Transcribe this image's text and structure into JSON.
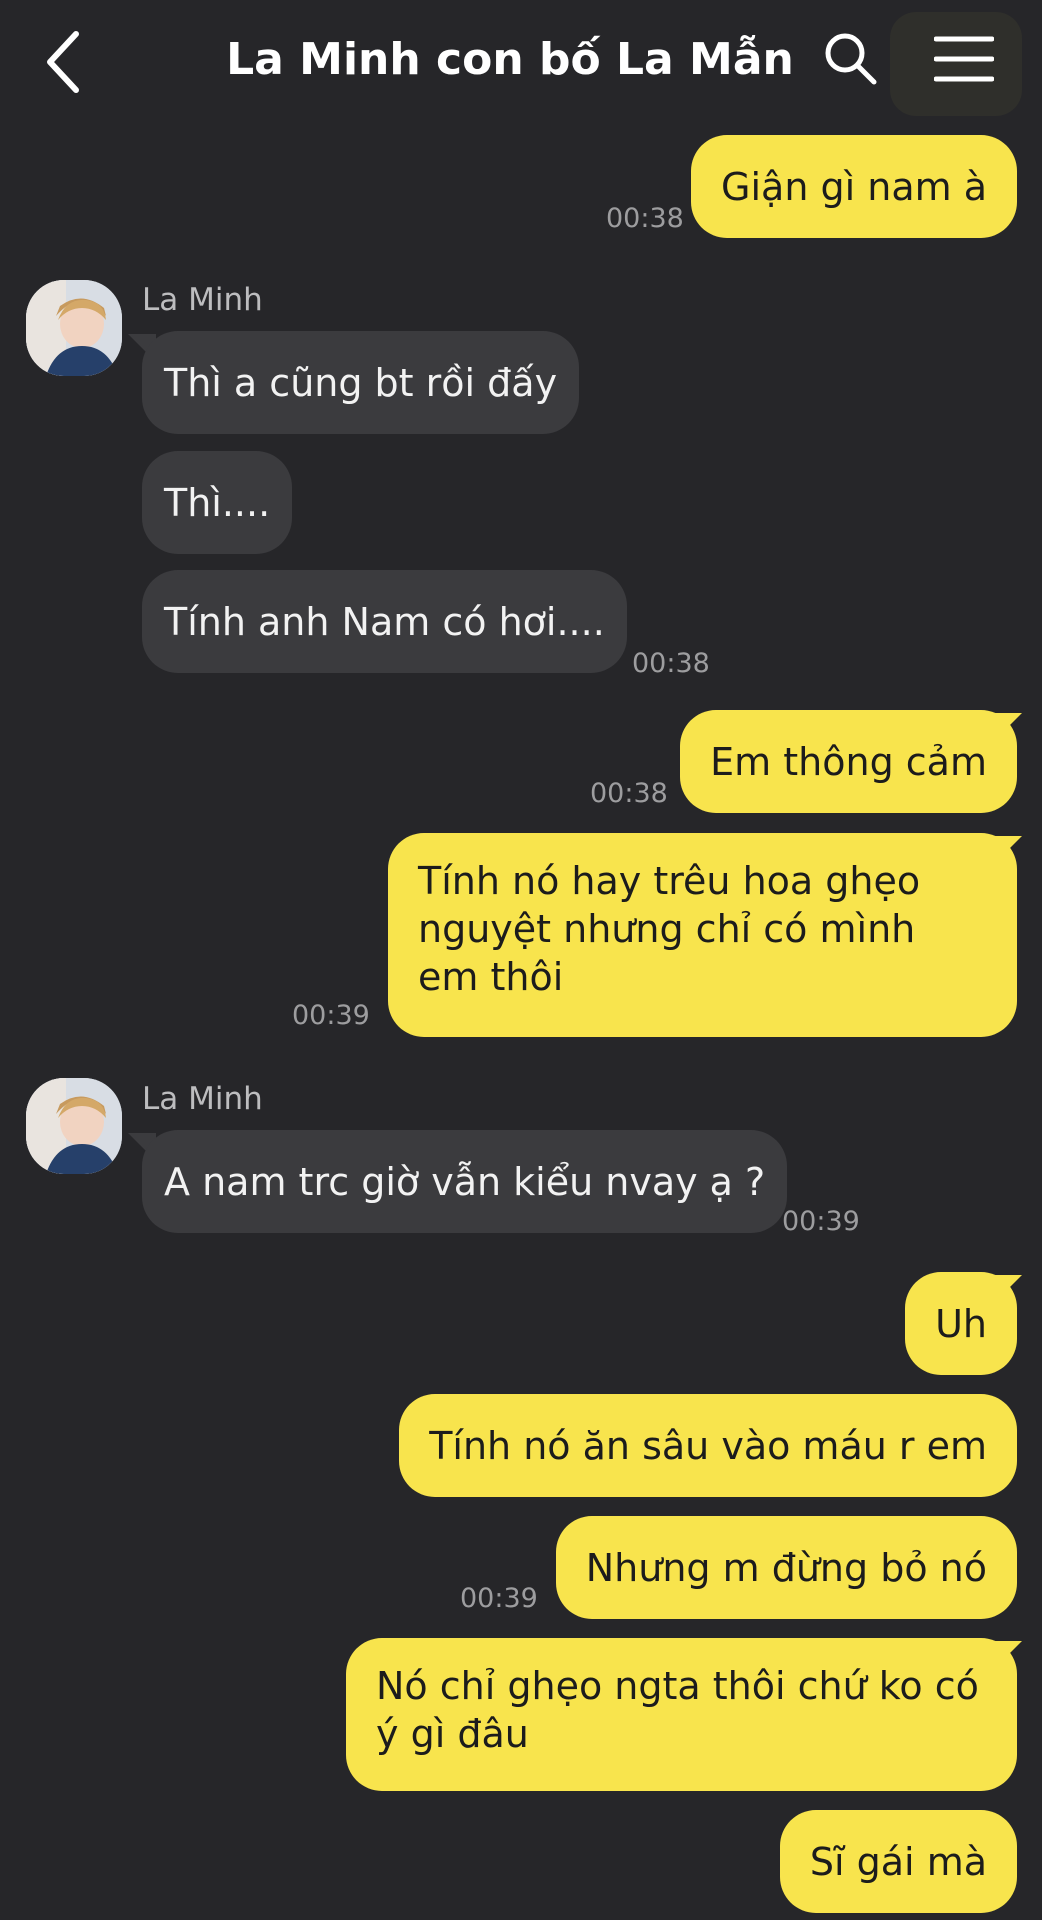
{
  "header": {
    "title": "La Minh con bố La Mẫn",
    "back_icon": "chevron-left-icon",
    "search_icon": "search-icon",
    "menu_icon": "hamburger-menu-icon"
  },
  "colors": {
    "background": "#262629",
    "my_bubble": "#f8e44d",
    "their_bubble": "#3b3b3e"
  },
  "messages": [
    {
      "from": "me",
      "text": "Giận gì nam à",
      "time": "00:38"
    },
    {
      "from": "them",
      "sender": "La Minh",
      "text": "Thì a cũng bt rồi đấy"
    },
    {
      "from": "them",
      "text": "Thì...."
    },
    {
      "from": "them",
      "text": "Tính anh Nam có hơi....",
      "time": "00:38"
    },
    {
      "from": "me",
      "text": "Em thông cảm",
      "time": "00:38"
    },
    {
      "from": "me",
      "text": "Tính nó hay trêu hoa ghẹo nguyệt nhưng chỉ có mình em thôi",
      "time": "00:39"
    },
    {
      "from": "them",
      "sender": "La Minh",
      "text": "A nam trc giờ vẫn kiểu nvay ạ ?",
      "time": "00:39"
    },
    {
      "from": "me",
      "text": "Uh"
    },
    {
      "from": "me",
      "text": "Tính nó ăn sâu vào máu r em"
    },
    {
      "from": "me",
      "text": "Nhưng m đừng bỏ nó",
      "time": "00:39"
    },
    {
      "from": "me",
      "text": "Nó chỉ ghẹo ngta thôi chứ ko có ý gì đâu"
    },
    {
      "from": "me",
      "text": "Sĩ gái mà"
    }
  ]
}
